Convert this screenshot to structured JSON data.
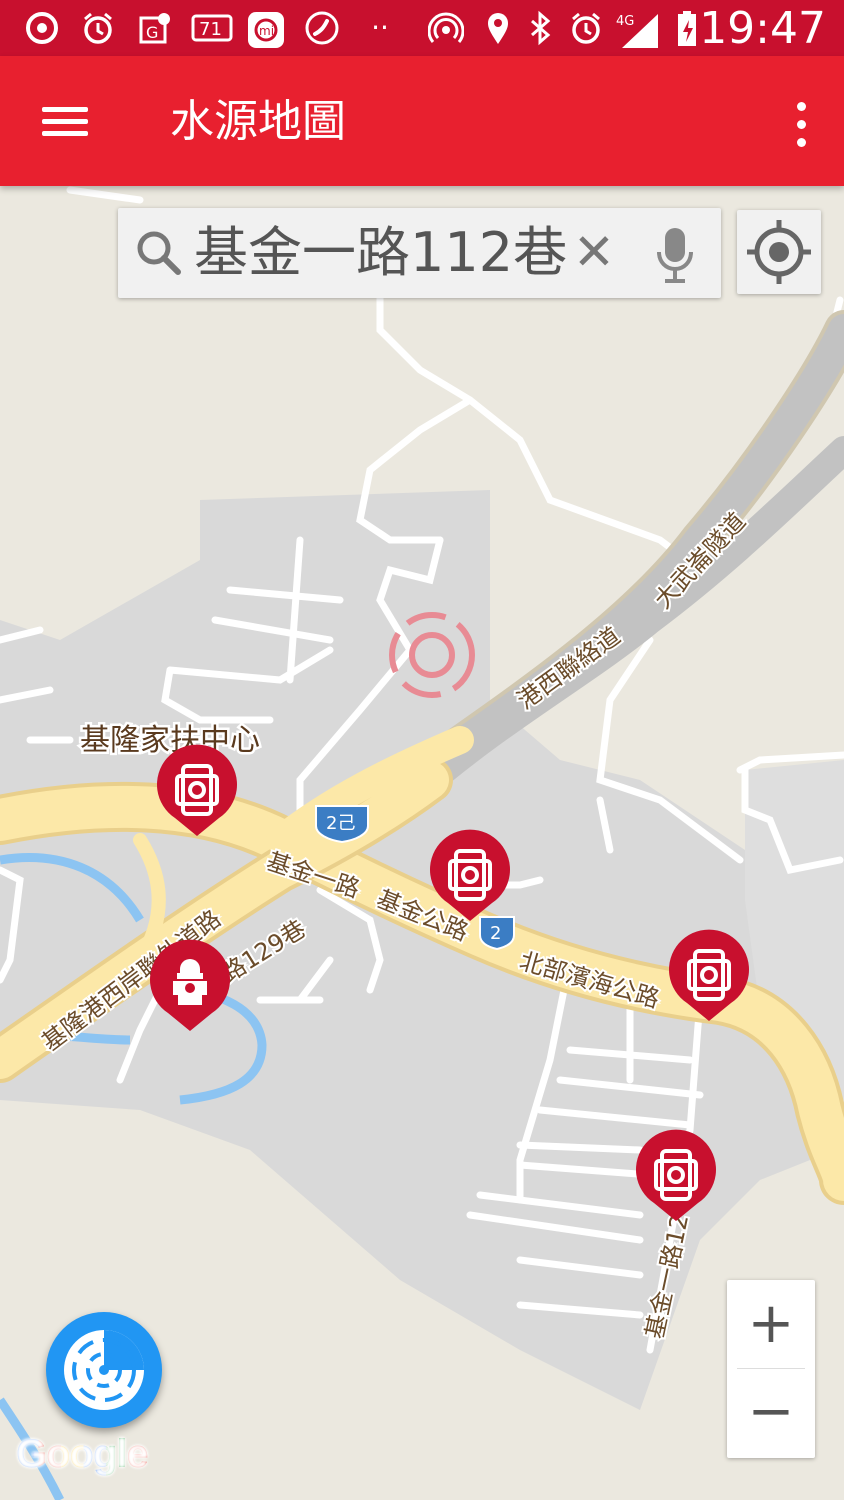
{
  "status_bar": {
    "time": "19:47",
    "network": "4G",
    "icons": [
      "chrome-icon",
      "alarm-icon",
      "maps-icon",
      "temperature-71-icon",
      "mi-icon",
      "phone-icon",
      "more-dots-icon",
      "hotspot-icon",
      "location-icon",
      "bluetooth-icon",
      "alarm-icon",
      "signal-icon",
      "battery-charging-icon"
    ],
    "temp_label": "71"
  },
  "app_bar": {
    "title": "水源地圖",
    "menu_icon": "hamburger-menu-icon",
    "overflow_icon": "more-vert-icon",
    "color": "#e8202f"
  },
  "search": {
    "query": "基金一路112巷",
    "clear_symbol": "✕",
    "search_icon": "search-icon",
    "mic_icon": "mic-icon"
  },
  "map": {
    "labels": {
      "place_1": "基隆家扶中心",
      "road_1": "港西聯絡道",
      "road_2": "大武崙隧道",
      "road_3": "基金一路",
      "road_4": "基金公路",
      "road_5": "北部濱海公路",
      "road_6": "基隆港西岸聯外道路",
      "road_7": "路129巷",
      "road_8": "基金一路12"
    },
    "shields": {
      "shield_1": "2己",
      "shield_2": "2"
    },
    "markers": [
      "hydrant-marker",
      "hydrant-marker",
      "hydrant-marker",
      "hydrant-marker",
      "fire-hydrant-marker"
    ],
    "colors": {
      "marker": "#c8102e",
      "road": "#fce8a8",
      "water": "#8cc4f2"
    }
  },
  "controls": {
    "zoom_in": "+",
    "zoom_out": "−",
    "locate_icon": "my-location-icon",
    "radar_icon": "radar-scan-icon"
  },
  "attribution": {
    "google": "Google"
  }
}
